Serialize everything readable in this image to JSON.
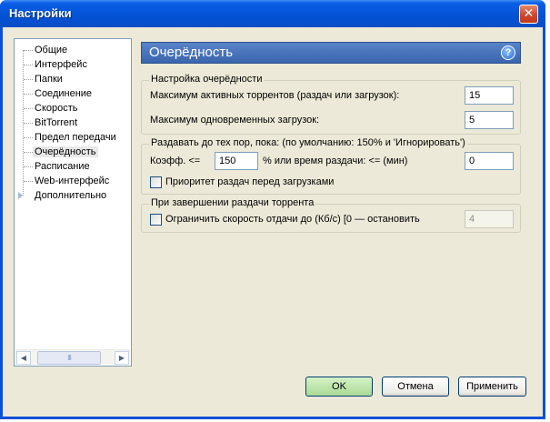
{
  "window": {
    "title": "Настройки"
  },
  "tree": {
    "items": [
      {
        "label": "Общие"
      },
      {
        "label": "Интерфейс"
      },
      {
        "label": "Папки"
      },
      {
        "label": "Соединение"
      },
      {
        "label": "Скорость"
      },
      {
        "label": "BitTorrent"
      },
      {
        "label": "Предел передачи"
      },
      {
        "label": "Очерёдность",
        "selected": true
      },
      {
        "label": "Расписание"
      },
      {
        "label": "Web-интерфейс"
      },
      {
        "label": "Дополнительно",
        "expandable": true
      }
    ],
    "scroll_thumb_glyph": "III"
  },
  "panel": {
    "title": "Очерёдность",
    "help_glyph": "?",
    "queue_group": {
      "label": "Настройка очерёдности",
      "max_active_label": "Максимум активных торрентов (раздач или загрузок):",
      "max_active_value": "15",
      "max_downloads_label": "Максимум одновременных загрузок:",
      "max_downloads_value": "5"
    },
    "seed_group": {
      "label": "Раздавать до тех пор, пока: (по умолчанию: 150% и 'Игнорировать')",
      "ratio_label": "Коэфф. <=",
      "ratio_value": "150",
      "time_label": "%  или время раздачи: <= (мин)",
      "time_value": "0",
      "priority_label": "Приоритет раздач перед загрузками"
    },
    "finish_group": {
      "label": "При завершении раздачи торрента",
      "limit_label": "Ограничить скорость отдачи до (Кб/с) [0 — остановить",
      "limit_value": "4"
    }
  },
  "buttons": {
    "ok": "OK",
    "cancel": "Отмена",
    "apply": "Применить"
  }
}
